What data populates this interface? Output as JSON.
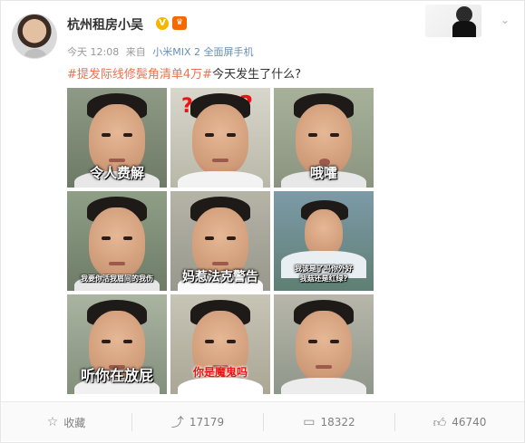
{
  "post": {
    "username": "杭州租房小吴",
    "verified_icon": "verified-v-icon",
    "member_icon": "vip-crown-icon",
    "time": "今天 12:08",
    "source_prefix": "来自",
    "device": "小米MIX 2 全面屏手机",
    "topic": "#提发际线修鬓角清单4万#",
    "text": "今天发生了什么?"
  },
  "grid": {
    "captions": [
      "令人费解",
      "",
      "哦嚯",
      "我要你活我眉间的我伤",
      "妈惹法克警告",
      "我该是了吗你外好\n我菇还是红绿?",
      "听你在放屁",
      "你是魔鬼吗",
      ""
    ]
  },
  "actions": {
    "favorite_label": "收藏",
    "repost_count": "17179",
    "comment_count": "18322",
    "like_count": "46740"
  },
  "colors": {
    "topic": "#eb7350",
    "device_link": "#6a8eb3",
    "verified": "#f7b500"
  }
}
